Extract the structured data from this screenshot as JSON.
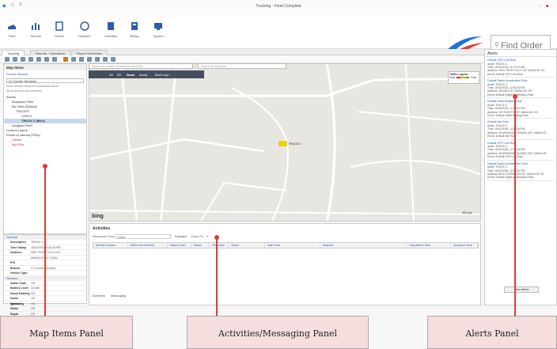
{
  "window": {
    "title": "Tracking - Fleet Complete"
  },
  "ribbon": {
    "items": [
      {
        "label": "Fleet",
        "icon": "fleet-icon"
      },
      {
        "label": "Reports",
        "icon": "reports-icon"
      },
      {
        "label": "Orders",
        "icon": "orders-icon"
      },
      {
        "label": "Dispatch",
        "icon": "dispatch-icon"
      },
      {
        "label": "Activities",
        "icon": "activities-icon"
      },
      {
        "label": "Billing",
        "icon": "billing-icon"
      },
      {
        "label": "System",
        "icon": "system-icon"
      }
    ],
    "find_order_placeholder": "Find Order"
  },
  "tabs": [
    "Tracking",
    "Reports - Operations",
    "Report Schedules"
  ],
  "toolbar": {
    "custom_layers": "Custom Layers"
  },
  "map_items": {
    "title": "Map Items",
    "current_branch": "Current Branch",
    "branch_select": "CI Courier Services",
    "check1": "Show deleted items from branches above",
    "check2": "Show items in sub-branches",
    "tree": [
      "Assets",
      "Brampton Fleet",
      "My Fleet (Default)",
      "TRUCKS",
      "CHEVY",
      "TRUCK 3 (Mike)",
      "Vaughan Fleet",
      "Custom Layers",
      "Points of Interest (POIs)",
      "Clients",
      "My POIs"
    ]
  },
  "properties": {
    "general_label": "General",
    "sensors_label": "Sensors",
    "general": [
      {
        "k": "Description",
        "v": "TRUCK 3"
      },
      {
        "k": "Time Stamp",
        "v": "16/02/2015 9:22:46 PM"
      },
      {
        "k": "Address",
        "v": "4001 TROUT LILLY LN"
      },
      {
        "k": "",
        "v": "MANLIUS, NY 13104"
      },
      {
        "k": "POI",
        "v": ""
      },
      {
        "k": "Branch",
        "v": "CI Courier Services"
      },
      {
        "k": "Vehicle Type",
        "v": ""
      }
    ],
    "sensors": [
      {
        "k": "Alarm Code",
        "v": "Off"
      },
      {
        "k": "Battery Level",
        "v": "12.600"
      },
      {
        "k": "Harsh Braking",
        "v": "Off"
      },
      {
        "k": "Harsh Cornering",
        "v": "Off"
      },
      {
        "k": "Ignition",
        "v": "On"
      },
      {
        "k": "Radio",
        "v": "Off"
      },
      {
        "k": "Rapid Accelerati",
        "v": "Off"
      }
    ]
  },
  "map": {
    "search1": "Search for Assets, Resources, and POIs",
    "search2": "Search for locations",
    "nav": [
      "2D",
      "3D",
      "Road",
      "Aerial",
      "Bird's eye"
    ],
    "legend_title": "Traffic Legend",
    "legend_slow": "Slow",
    "legend_fast": "Fast",
    "truck_label": "TRUCK 3",
    "bing": "bing",
    "scale": "500 yds"
  },
  "activities": {
    "title": "Activities",
    "resource_crew_label": "Resource Crew",
    "resource_crew_value": "Crew",
    "dispatch": "Dispatch",
    "zoom_to": "Zoom To",
    "columns": [
      "Activity Number",
      "Reference Number",
      "Status Code",
      "Status",
      "Resource",
      "Name",
      "Start Time",
      "Address",
      "Dispatched Time",
      "Accepted Time"
    ],
    "tabs": [
      "Activities",
      "Messaging"
    ]
  },
  "alerts": {
    "title": "Alerts",
    "view_button": "View Alerts",
    "items": [
      {
        "title": "Default GPS Lost Rule",
        "asset": "TRUCK 3",
        "time": "15/02/2015, 11:07:00 AM",
        "address": "4001 TROUT LILLY LN, MANLIUS, NY",
        "event": "Default GPS Lost Rule"
      },
      {
        "title": "Default Rapid Acceleration Rule",
        "asset": "TRUCK 3",
        "time": "15/02/2015, 12:06:00 PM",
        "address": "28 HAYS ST, MANLIUS, NY",
        "event": "Default Rapid Acceleration Rule"
      },
      {
        "title": "Default Harsh Braking Rule",
        "asset": "TRUCK 3",
        "time": "15/02/2015, 12:06:30 PM",
        "address": "322 FAYETTE ST, MANLIUS, NY",
        "event": "Default Harsh Braking Rule"
      },
      {
        "title": "Default Idle Rule",
        "asset": "TRUCK 3",
        "time": "15/02/2015, 12:13:00 PM",
        "address": "28 ARKEDALE RANDE AVE, MANLIUS...",
        "event": "Default Idle Rule"
      },
      {
        "title": "Default GPS Lost Rule",
        "asset": "TRUCK 3",
        "time": "15/02/2015, 12:30:45 PM",
        "address": "28 ARKEDALE RANDE AVE, MANLIUS...",
        "event": "Default GPS Lost Rule"
      },
      {
        "title": "Default Rapid Acceleration Rule",
        "asset": "TRUCK 3",
        "time": "15/02/2015, 12:54:32 PM",
        "address": "8014 CAZENOVIA RD, MANLIUS, NY",
        "event": "Default Rapid Acceleration Rule"
      }
    ]
  },
  "callouts": {
    "map_items": "Map Items Panel",
    "activities": "Activities/Messaging Panel",
    "alerts": "Alerts Panel"
  },
  "colors": {
    "accent": "#2a5db0",
    "callout_bg": "#f6dede",
    "pointer": "#e53935",
    "truck": "#e8d300"
  }
}
